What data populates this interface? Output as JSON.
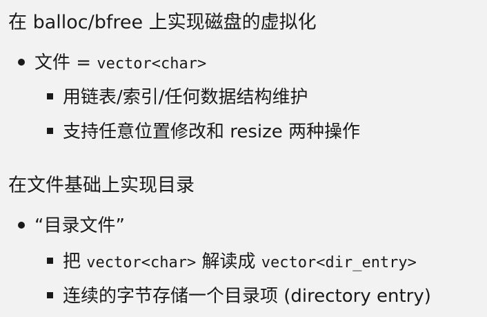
{
  "section1": {
    "heading": "在 balloc/bfree 上实现磁盘的虚拟化",
    "bullet": {
      "text_prefix": "文件 = ",
      "code": "vector<char>"
    },
    "subitems": [
      "用链表/索引/任何数据结构维护",
      "支持任意位置修改和 resize 两种操作"
    ]
  },
  "section2": {
    "heading": "在文件基础上实现目录",
    "bullet": {
      "text": "“目录文件”"
    },
    "subitem1": {
      "prefix": "把 ",
      "code1": "vector<char>",
      "middle": " 解读成 ",
      "code2": "vector<dir_entry>"
    },
    "subitem2": "连续的字节存储一个目录项 (directory entry)"
  }
}
